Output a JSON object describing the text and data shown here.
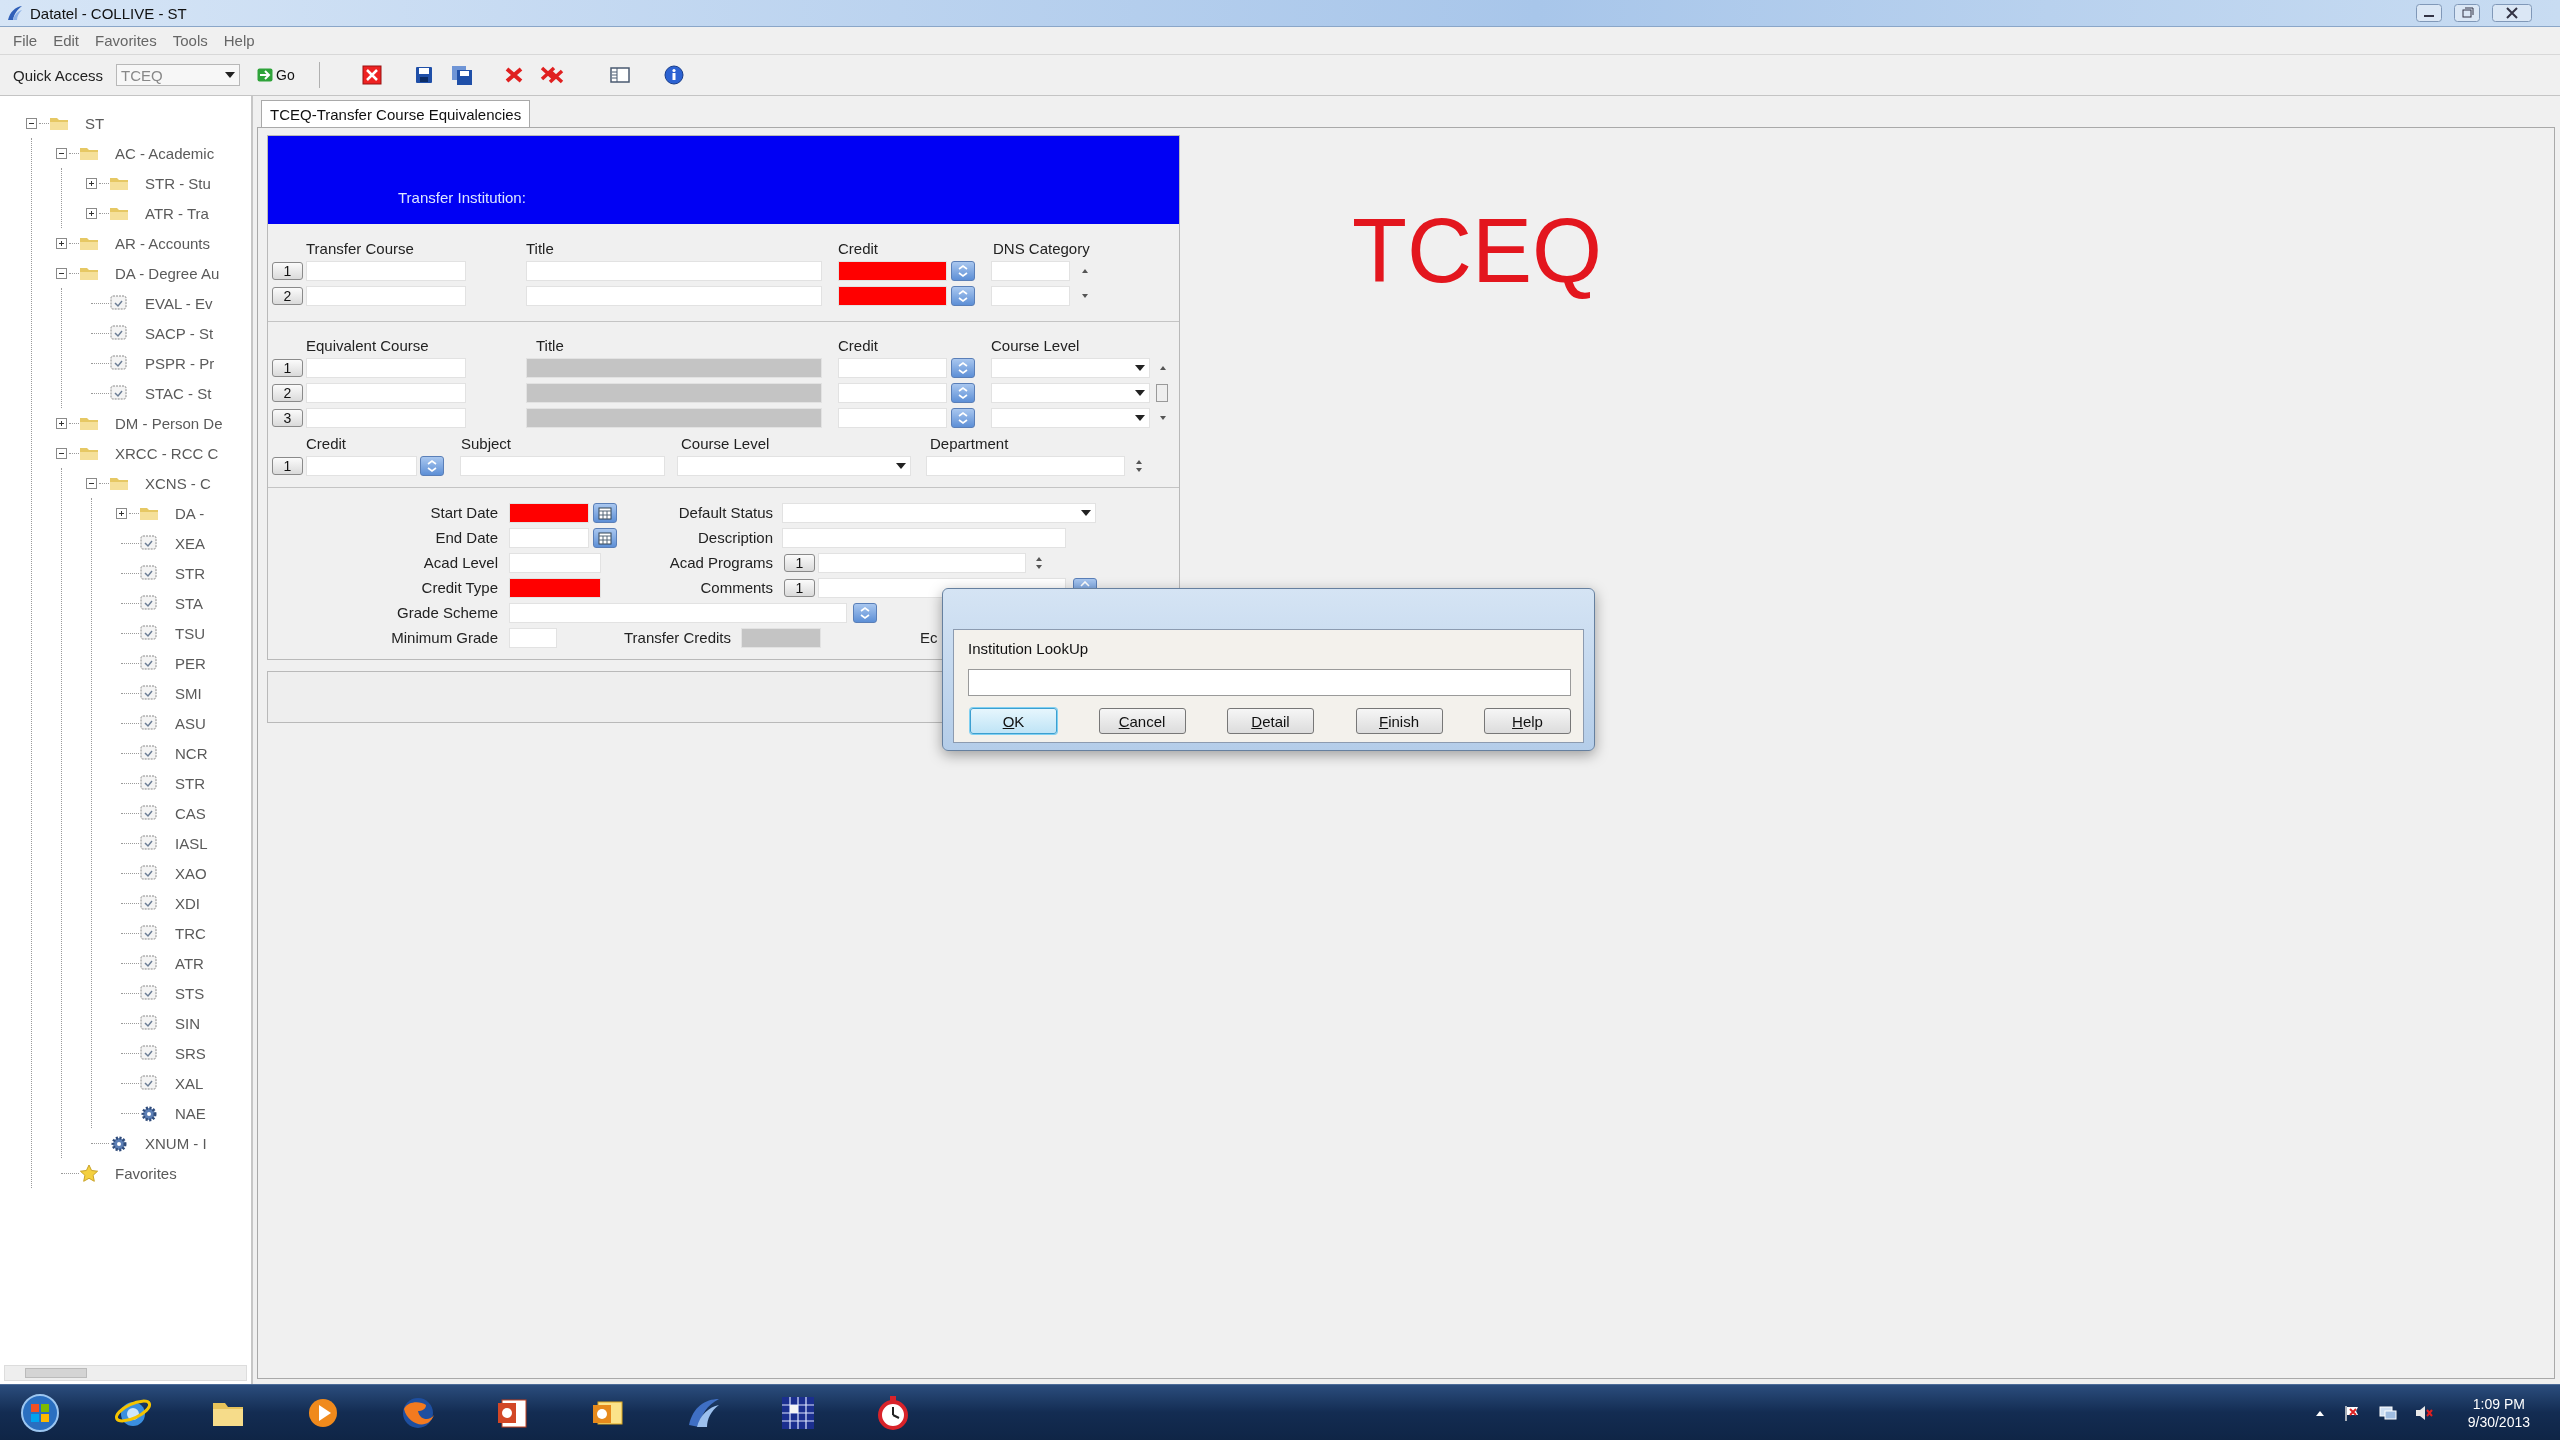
{
  "window": {
    "title": "Datatel - COLLIVE - ST"
  },
  "menu": [
    "File",
    "Edit",
    "Favorites",
    "Tools",
    "Help"
  ],
  "toolbar": {
    "quick_access": {
      "label": "Quick Access",
      "value": "TCEQ"
    },
    "go": {
      "label": "Go"
    },
    "tools": [
      {
        "kind": "close"
      },
      {
        "kind": "save"
      },
      {
        "kind": "save_all"
      },
      {
        "kind": "cancel"
      },
      {
        "kind": "cancel_all"
      },
      {
        "kind": "panel"
      },
      {
        "kind": "help"
      }
    ]
  },
  "tree": [
    {
      "label": "ST",
      "kind": "folder",
      "expanded": true,
      "children": [
        {
          "label": "AC - Academic",
          "kind": "folder",
          "expanded": true,
          "children": [
            {
              "label": "STR - Stu",
              "kind": "folder",
              "expanded": false
            },
            {
              "label": "ATR - Tra",
              "kind": "folder",
              "expanded": false
            }
          ]
        },
        {
          "label": "AR - Accounts",
          "kind": "folder",
          "expanded": false
        },
        {
          "label": "DA - Degree Au",
          "kind": "folder",
          "expanded": true,
          "children": [
            {
              "label": "EVAL - Ev",
              "kind": "form"
            },
            {
              "label": "SACP - St",
              "kind": "form"
            },
            {
              "label": "PSPR - Pr",
              "kind": "form"
            },
            {
              "label": "STAC - St",
              "kind": "form"
            }
          ]
        },
        {
          "label": "DM - Person De",
          "kind": "folder",
          "expanded": false
        },
        {
          "label": "XRCC - RCC C",
          "kind": "folder",
          "expanded": true,
          "children": [
            {
              "label": "XCNS - C",
              "kind": "folder",
              "expanded": true,
              "children": [
                {
                  "label": "DA -",
                  "kind": "folder",
                  "expanded": false
                },
                {
                  "label": "XEA",
                  "kind": "form"
                },
                {
                  "label": "STR",
                  "kind": "form"
                },
                {
                  "label": "STA",
                  "kind": "form"
                },
                {
                  "label": "TSU",
                  "kind": "form"
                },
                {
                  "label": "PER",
                  "kind": "form"
                },
                {
                  "label": "SMI",
                  "kind": "form"
                },
                {
                  "label": "ASU",
                  "kind": "form"
                },
                {
                  "label": "NCR",
                  "kind": "form"
                },
                {
                  "label": "STR",
                  "kind": "form"
                },
                {
                  "label": "CAS",
                  "kind": "form"
                },
                {
                  "label": "IASL",
                  "kind": "form"
                },
                {
                  "label": "XAO",
                  "kind": "form"
                },
                {
                  "label": "XDI",
                  "kind": "form"
                },
                {
                  "label": "TRC",
                  "kind": "form"
                },
                {
                  "label": "ATR",
                  "kind": "form"
                },
                {
                  "label": "STS",
                  "kind": "form"
                },
                {
                  "label": "SIN",
                  "kind": "form"
                },
                {
                  "label": "SRS",
                  "kind": "form"
                },
                {
                  "label": "XAL",
                  "kind": "form"
                },
                {
                  "label": "NAE",
                  "kind": "process"
                }
              ]
            },
            {
              "label": "XNUM - I",
              "kind": "process"
            }
          ]
        },
        {
          "label": "Favorites",
          "kind": "favorites"
        }
      ]
    }
  ],
  "document_tab": {
    "label": "TCEQ-Transfer Course Equivalencies",
    "selected": true
  },
  "form": {
    "header": {
      "label": "Transfer Institution:"
    },
    "transfer_courses": {
      "columns": [
        "Transfer Course",
        "Title",
        "Credit",
        "DNS Category"
      ],
      "rows": [
        {
          "number": "1",
          "credit_required": true
        },
        {
          "number": "2",
          "credit_required": true
        }
      ]
    },
    "equivalent_courses": {
      "columns": [
        "Equivalent Course",
        "Title",
        "Credit",
        "Course Level"
      ],
      "rows": [
        {
          "number": "1",
          "title_disabled": true
        },
        {
          "number": "2",
          "title_disabled": true
        },
        {
          "number": "3",
          "title_disabled": true
        }
      ]
    },
    "credit_options": {
      "columns": [
        "Credit",
        "Subject",
        "Course Level",
        "Department"
      ],
      "rows": [
        {
          "number": "1"
        }
      ]
    },
    "details": [
      {
        "left": {
          "label": "Start Date",
          "kind": "date",
          "required": true
        },
        "right": {
          "label": "Default Status",
          "kind": "dropdown"
        }
      },
      {
        "left": {
          "label": "End Date",
          "kind": "date",
          "required": false
        },
        "right": {
          "label": "Description",
          "kind": "text"
        }
      },
      {
        "left": {
          "label": "Acad Level",
          "kind": "text",
          "required": false
        },
        "right": {
          "label": "Acad Programs",
          "kind": "list_spinner",
          "button": "1"
        }
      },
      {
        "left": {
          "label": "Credit Type",
          "kind": "text",
          "required": true
        },
        "right": {
          "label": "Comments",
          "kind": "list_lookup",
          "button": "1"
        }
      },
      {
        "left": {
          "label": "Grade Scheme",
          "kind": "lookup",
          "required": false
        }
      },
      {
        "left": {
          "label": "Minimum Grade",
          "kind": "short",
          "required": false
        },
        "inline": {
          "label": "Transfer Credits",
          "kind": "readonly"
        },
        "trailing_label": "Ec"
      }
    ]
  },
  "caption": "TCEQ",
  "dialog": {
    "label": "Institution LookUp",
    "buttons": [
      {
        "access": "O",
        "rest": "K",
        "default": true
      },
      {
        "access": "C",
        "rest": "ancel",
        "default": false
      },
      {
        "access": "D",
        "rest": "etail",
        "default": false
      },
      {
        "access": "F",
        "rest": "inish",
        "default": false
      },
      {
        "access": "H",
        "rest": "elp",
        "default": false
      }
    ]
  },
  "taskbar": {
    "apps": [
      {
        "kind": "start"
      },
      {
        "kind": "browser"
      },
      {
        "kind": "files"
      },
      {
        "kind": "media"
      },
      {
        "kind": "firefox"
      },
      {
        "kind": "slides"
      },
      {
        "kind": "mail"
      },
      {
        "kind": "datatel"
      },
      {
        "kind": "grid"
      },
      {
        "kind": "timer"
      }
    ],
    "tray": [
      {
        "kind": "arrow"
      },
      {
        "kind": "flag"
      },
      {
        "kind": "network"
      },
      {
        "kind": "speaker"
      }
    ],
    "time": "1:09 PM",
    "date": "9/30/2013"
  }
}
